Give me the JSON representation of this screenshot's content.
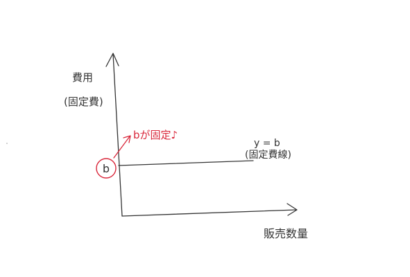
{
  "diagram": {
    "y_axis_label_line1": "費用",
    "y_axis_label_line2": "(固定費)",
    "intercept_label": "b",
    "annotation": "bが固定♪",
    "line_label_line1": "y = b",
    "line_label_line2": "(固定費線)",
    "x_axis_label": "販売数量"
  },
  "colors": {
    "ink": "#333333",
    "accent": "#d9263a"
  }
}
